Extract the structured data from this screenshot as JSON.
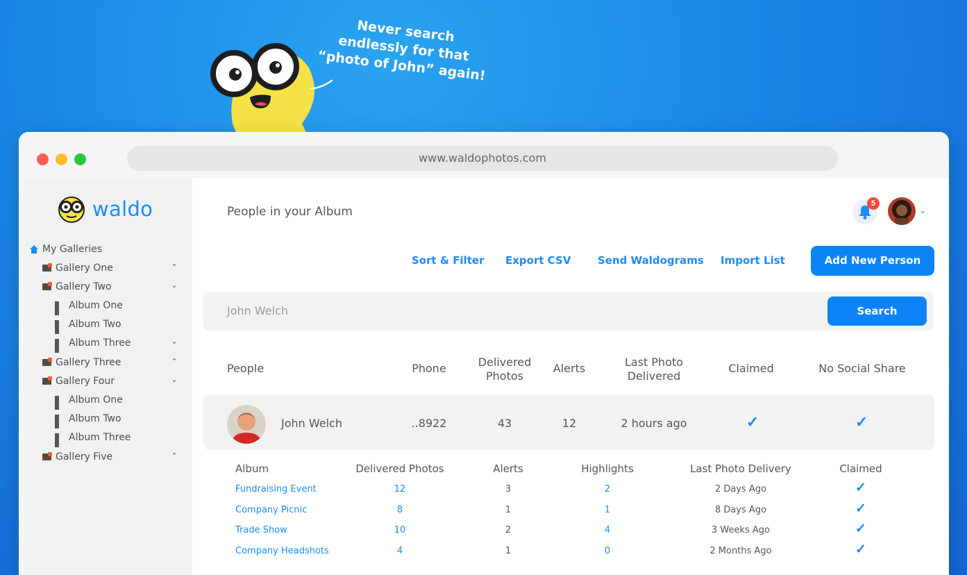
{
  "marketing": {
    "tagline_line1": "Never search",
    "tagline_line2": "endlessly for that",
    "tagline_line3": "“photo of John” again!"
  },
  "browser": {
    "url": "www.waldophotos.com"
  },
  "sidebar": {
    "logo_text": "waldo",
    "root_label": "My Galleries",
    "items": [
      {
        "label": "Gallery One",
        "type": "gallery",
        "chevron": "up"
      },
      {
        "label": "Gallery Two",
        "type": "gallery",
        "chevron": "down"
      },
      {
        "label": "Album One",
        "type": "album",
        "chevron": ""
      },
      {
        "label": "Album Two",
        "type": "album",
        "chevron": ""
      },
      {
        "label": "Album Three",
        "type": "album",
        "chevron": "down"
      },
      {
        "label": "Gallery Three",
        "type": "gallery",
        "chevron": "up"
      },
      {
        "label": "Gallery Four",
        "type": "gallery",
        "chevron": "down"
      },
      {
        "label": "Album One",
        "type": "album",
        "chevron": ""
      },
      {
        "label": "Album Two",
        "type": "album",
        "chevron": ""
      },
      {
        "label": "Album Three",
        "type": "album",
        "chevron": ""
      },
      {
        "label": "Gallery Five",
        "type": "gallery",
        "chevron": "up"
      }
    ]
  },
  "header": {
    "title": "People in your Album",
    "notification_count": "5"
  },
  "actions": {
    "sort_filter": "Sort & Filter",
    "export_csv": "Export CSV",
    "send_waldograms": "Send Waldograms",
    "import_list": "Import List",
    "add_new_person": "Add New Person"
  },
  "search": {
    "value": "John Welch",
    "button": "Search"
  },
  "people_table": {
    "headers": {
      "people": "People",
      "phone": "Phone",
      "delivered_1": "Delivered",
      "delivered_2": "Photos",
      "alerts": "Alerts",
      "last_1": "Last Photo",
      "last_2": "Delivered",
      "claimed": "Claimed",
      "no_social": "No Social Share"
    },
    "row": {
      "name": "John Welch",
      "phone": "..8922",
      "delivered": "43",
      "alerts": "12",
      "last_delivered": "2 hours ago",
      "claimed": true,
      "no_social_share": true
    }
  },
  "album_table": {
    "headers": {
      "album": "Album",
      "delivered": "Delivered Photos",
      "alerts": "Alerts",
      "highlights": "Highlights",
      "last_delivery": "Last Photo Delivery",
      "claimed": "Claimed"
    },
    "rows": [
      {
        "album": "Fundraising Event",
        "delivered": "12",
        "alerts": "3",
        "highlights": "2",
        "last": "2 Days Ago",
        "claimed": true
      },
      {
        "album": "Company Picnic",
        "delivered": "8",
        "alerts": "1",
        "highlights": "1",
        "last": "8 Days Ago",
        "claimed": true
      },
      {
        "album": "Trade Show",
        "delivered": "10",
        "alerts": "2",
        "highlights": "4",
        "last": "3 Weeks Ago",
        "claimed": true
      },
      {
        "album": "Company Headshots",
        "delivered": "4",
        "alerts": "1",
        "highlights": "0",
        "last": "2 Months Ago",
        "claimed": true
      }
    ]
  },
  "colors": {
    "accent": "#0c84f7",
    "background": "#1a86e6",
    "badge": "#f24b3d"
  }
}
